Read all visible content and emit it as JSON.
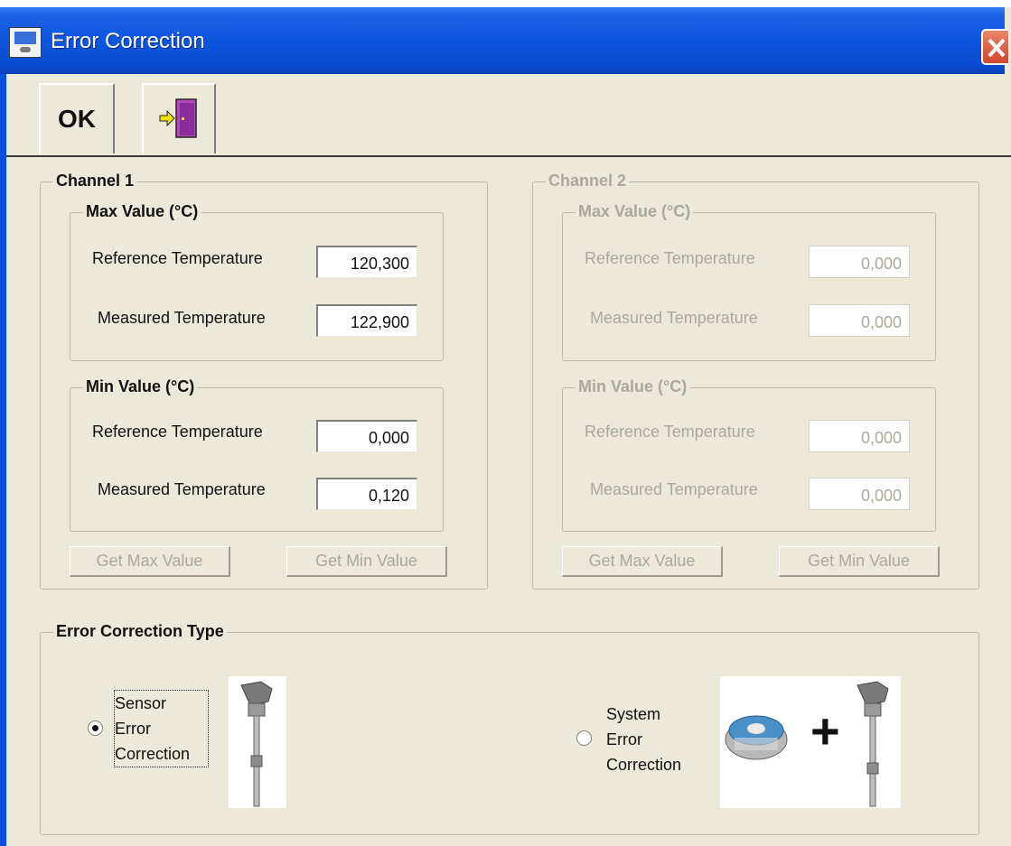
{
  "window": {
    "title": "Error Correction",
    "icon": "monitor-icon"
  },
  "toolbar": {
    "ok_label": "OK",
    "exit_icon": "exit-door-icon"
  },
  "channel1": {
    "title": "Channel 1",
    "max": {
      "title": "Max Value (°C)",
      "ref_label": "Reference Temperature",
      "ref_value": "120,300",
      "meas_label": "Measured Temperature",
      "meas_value": "122,900"
    },
    "min": {
      "title": "Min Value (°C)",
      "ref_label": "Reference Temperature",
      "ref_value": "0,000",
      "meas_label": "Measured Temperature",
      "meas_value": "0,120"
    },
    "get_max_label": "Get Max Value",
    "get_min_label": "Get Min Value"
  },
  "channel2": {
    "title": "Channel 2",
    "max": {
      "title": "Max Value (°C)",
      "ref_label": "Reference Temperature",
      "ref_value": "0,000",
      "meas_label": "Measured Temperature",
      "meas_value": "0,000"
    },
    "min": {
      "title": "Min Value (°C)",
      "ref_label": "Reference Temperature",
      "ref_value": "0,000",
      "meas_label": "Measured Temperature",
      "meas_value": "0,000"
    },
    "get_max_label": "Get Max Value",
    "get_min_label": "Get Min Value"
  },
  "correction": {
    "title": "Error Correction Type",
    "sensor": {
      "line1": "Sensor",
      "line2": "Error",
      "line3": "Correction",
      "selected": true
    },
    "system": {
      "line1": "System",
      "line2": "Error",
      "line3": "Correction",
      "selected": false
    },
    "plus": "+"
  }
}
